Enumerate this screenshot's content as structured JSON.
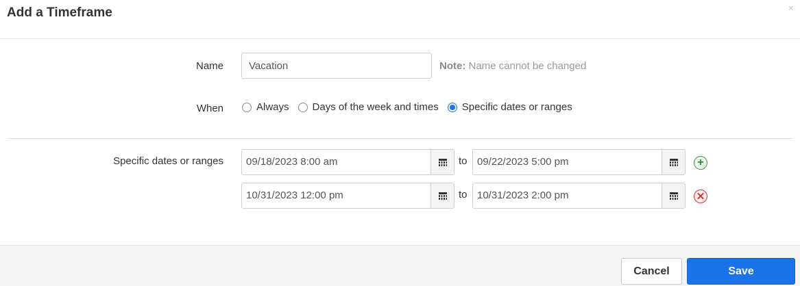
{
  "dialog": {
    "title": "Add a Timeframe",
    "close_icon": "close-icon",
    "close_glyph": "×"
  },
  "name_field": {
    "label": "Name",
    "value": "Vacation",
    "note_prefix": "Note:",
    "note_text": " Name cannot be changed"
  },
  "when": {
    "label": "When",
    "options": [
      {
        "label": "Always",
        "checked": false
      },
      {
        "label": "Days of the week and times",
        "checked": false
      },
      {
        "label": "Specific dates or ranges",
        "checked": true
      }
    ]
  },
  "ranges": {
    "label": "Specific dates or ranges",
    "to_label": "to",
    "rows": [
      {
        "start": "09/18/2023 8:00 am",
        "end": "09/22/2023 5:00 pm",
        "action": "add",
        "action_icon": "add-circle-icon",
        "action_glyph": "+"
      },
      {
        "start": "10/31/2023 12:00 pm",
        "end": "10/31/2023 2:00 pm",
        "action": "remove",
        "action_icon": "remove-circle-icon",
        "action_glyph": "✕"
      }
    ],
    "calendar_icon": "calendar-icon"
  },
  "footer": {
    "cancel_label": "Cancel",
    "save_label": "Save"
  },
  "colors": {
    "accent": "#1a73e8",
    "add": "#2e8b2e",
    "remove": "#d63333"
  }
}
